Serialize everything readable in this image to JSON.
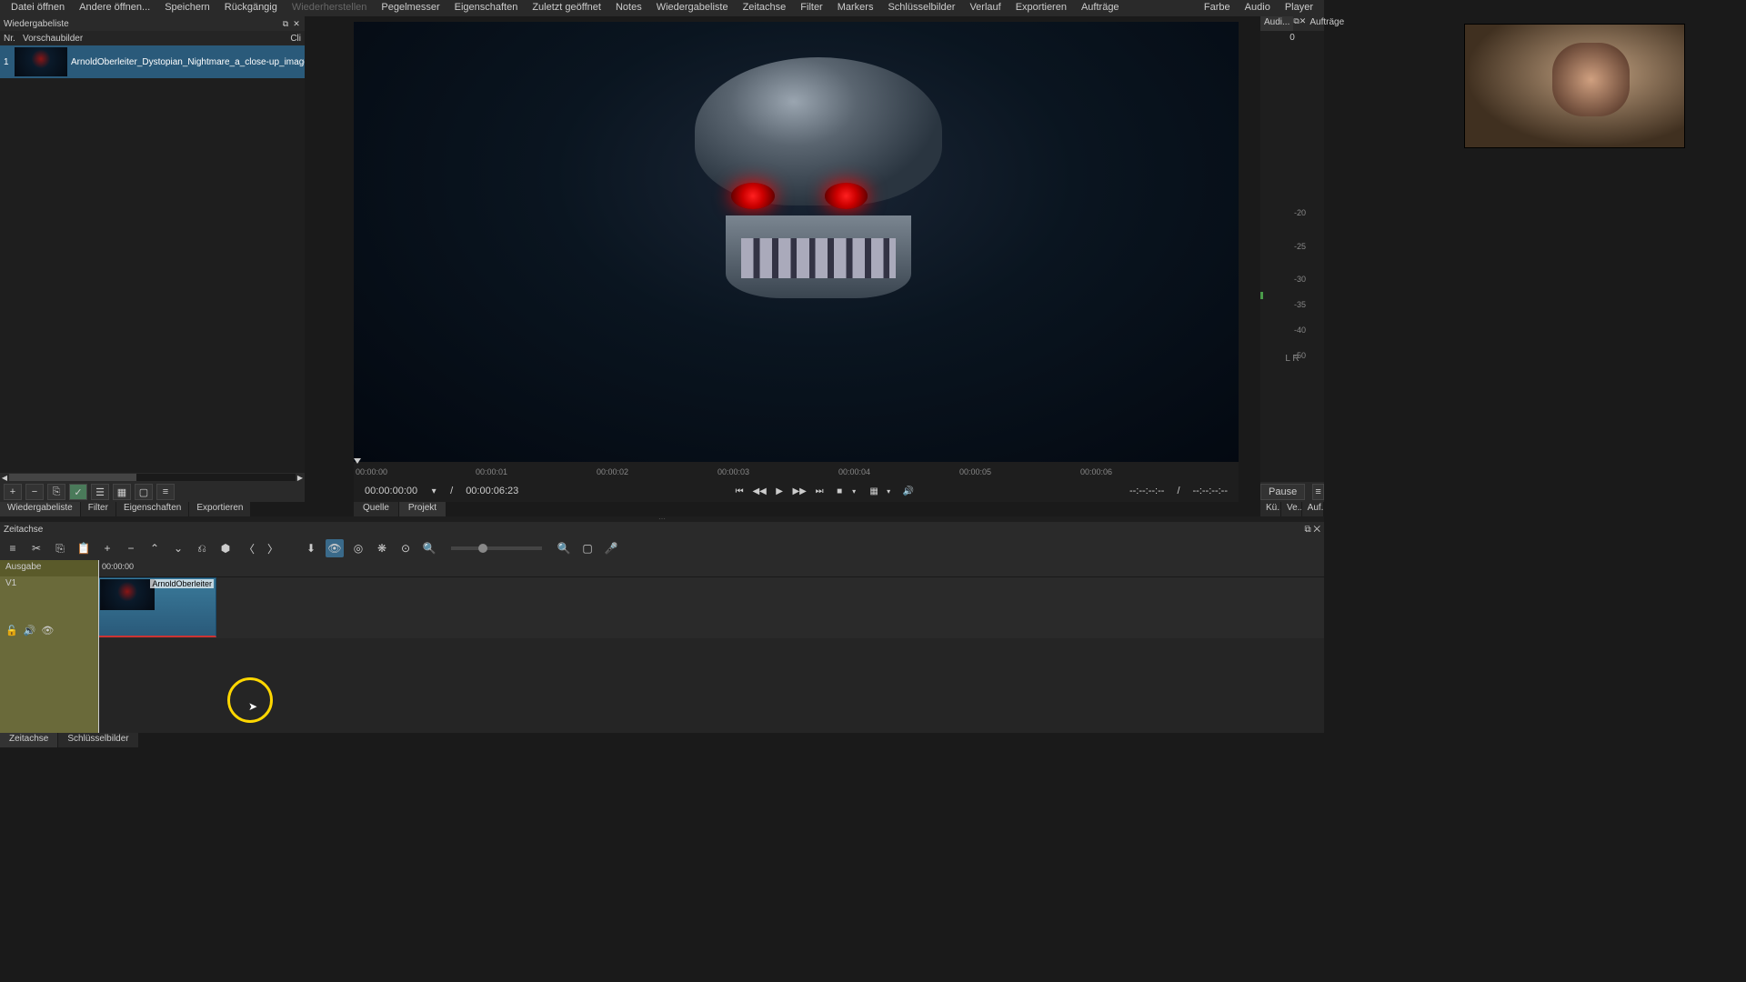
{
  "menu": {
    "items": [
      "Datei öffnen",
      "Andere öffnen...",
      "Speichern",
      "Rückgängig",
      "Wiederherstellen",
      "Pegelmesser",
      "Eigenschaften",
      "Zuletzt geöffnet",
      "Notes",
      "Wiedergabeliste",
      "Zeitachse",
      "Filter",
      "Markers",
      "Schlüsselbilder",
      "Verlauf",
      "Exportieren",
      "Aufträge"
    ],
    "disabled_index": 4,
    "right_items": [
      "Farbe",
      "Audio",
      "Player"
    ]
  },
  "playlist": {
    "title": "Wiedergabeliste",
    "cols": {
      "nr": "Nr.",
      "thumb": "Vorschaubilder",
      "cli": "Cli"
    },
    "item": {
      "num": "1",
      "name": "ArnoldOberleiter_Dystopian_Nightmare_a_close-up_image"
    },
    "toolbar_icons": [
      "+",
      "−",
      "⎘",
      "✓",
      "☰",
      "▦",
      "▢",
      "≡"
    ],
    "tabs": [
      "Wiedergabeliste",
      "Filter",
      "Eigenschaften",
      "Exportieren"
    ]
  },
  "scrubber": {
    "ticks": [
      "00:00:00",
      "00:00:01",
      "00:00:02",
      "00:00:03",
      "00:00:04",
      "00:00:05",
      "00:00:06"
    ]
  },
  "transport": {
    "current": "00:00:00:00",
    "sep": "/",
    "total": "00:00:06:23",
    "right1": "--:--:--:--",
    "right_sep": "/",
    "right2": "--:--:--:--"
  },
  "src_proj": {
    "tabs": [
      "Quelle",
      "Projekt"
    ]
  },
  "right": {
    "top_tabs": [
      "Audi...",
      "Aufträge"
    ],
    "zero": "0",
    "levels": [
      "-20",
      "-25",
      "-30",
      "-35",
      "-40",
      "-50"
    ],
    "lr": "L   R",
    "pause": "Pause",
    "bottom_tabs": [
      "Kü...",
      "Ve...",
      "Auf..."
    ]
  },
  "timeline": {
    "title": "Zeitachse",
    "header_output": "Ausgabe",
    "ruler": "00:00:00",
    "track": "V1",
    "clip_label": "ArnoldOberleiter",
    "tabs": [
      "Zeitachse",
      "Schlüsselbilder"
    ]
  }
}
